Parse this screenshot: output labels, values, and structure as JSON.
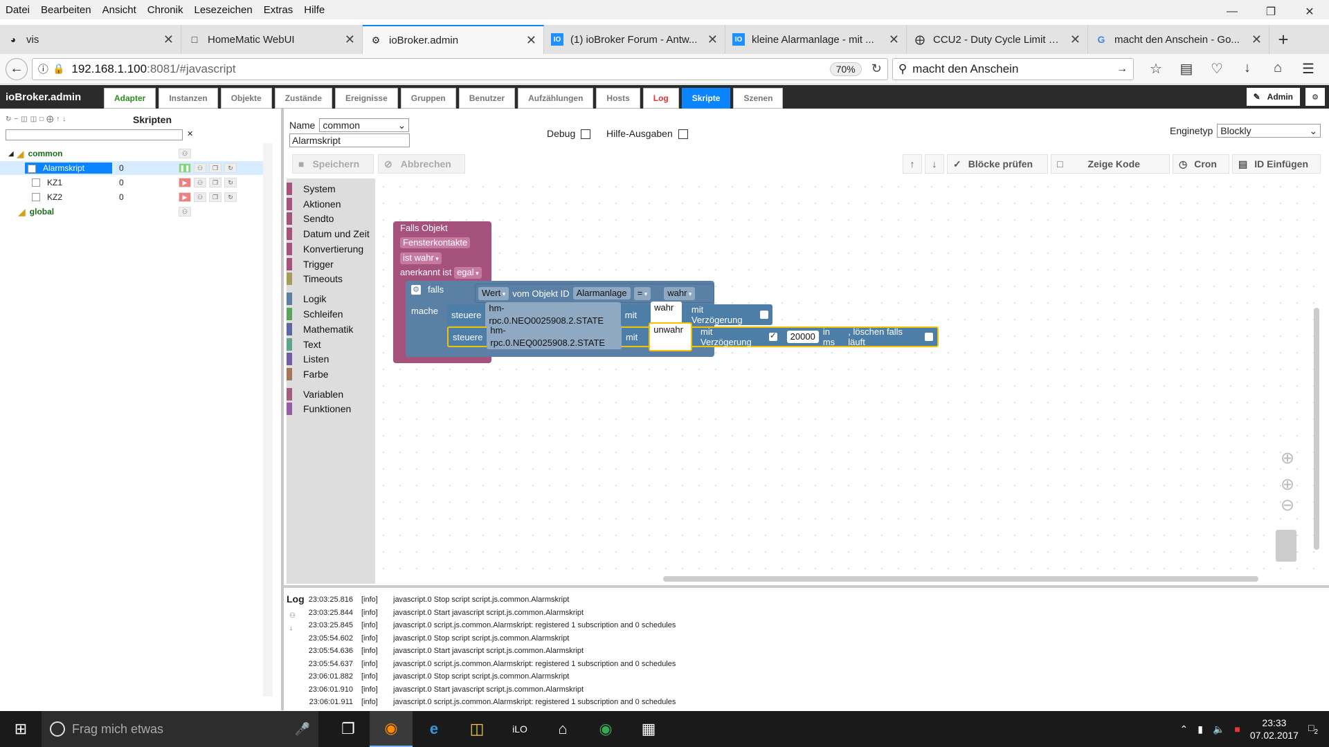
{
  "menu": [
    "Datei",
    "Bearbeiten",
    "Ansicht",
    "Chronik",
    "Lesezeichen",
    "Extras",
    "Hilfe"
  ],
  "tabs": [
    {
      "label": "vis",
      "icon": "vis-icon"
    },
    {
      "label": "HomeMatic WebUI",
      "icon": "page-icon"
    },
    {
      "label": "ioBroker.admin",
      "icon": "gear-icon"
    },
    {
      "label": "(1) ioBroker Forum - Antw...",
      "icon": "iobroker-icon"
    },
    {
      "label": "kleine Alarmanlage - mit ...",
      "icon": "iobroker-icon"
    },
    {
      "label": "CCU2 - Duty Cycle Limit er...",
      "icon": "ccu-icon"
    },
    {
      "label": "macht den Anschein - Go...",
      "icon": "google-icon"
    }
  ],
  "url": {
    "host": "192.168.1.100",
    "path": ":8081/#javascript",
    "zoom": "70%"
  },
  "search": {
    "value": "macht den Anschein"
  },
  "admin": {
    "brand": "ioBroker.admin",
    "tabs": [
      "Adapter",
      "Instanzen",
      "Objekte",
      "Zustände",
      "Ereignisse",
      "Gruppen",
      "Benutzer",
      "Aufzählungen",
      "Hosts",
      "Log",
      "Skripte",
      "Szenen"
    ],
    "user": "Admin"
  },
  "scripts": {
    "title": "Skripten",
    "folders": [
      {
        "name": "common",
        "items": [
          {
            "name": "Alarmskript",
            "value": "0"
          },
          {
            "name": "KZ1",
            "value": "0"
          },
          {
            "name": "KZ2",
            "value": "0"
          }
        ]
      },
      {
        "name": "global",
        "items": []
      }
    ]
  },
  "editor": {
    "name_label": "Name",
    "folder": "common",
    "script_name": "Alarmskript",
    "debug_label": "Debug",
    "hilfe_label": "Hilfe-Ausgaben",
    "engine_label": "Enginetyp",
    "engine": "Blockly",
    "buttons": {
      "save": "Speichern",
      "cancel": "Abbrechen",
      "check": "Blöcke prüfen",
      "code": "Zeige Kode",
      "cron": "Cron",
      "id": "ID Einfügen"
    }
  },
  "toolbox": [
    "System",
    "Aktionen",
    "Sendto",
    "Datum und Zeit",
    "Konvertierung",
    "Trigger",
    "Timeouts",
    "Logik",
    "Schleifen",
    "Mathematik",
    "Text",
    "Listen",
    "Farbe",
    "Variablen",
    "Funktionen"
  ],
  "toolbox_colors": [
    "#a5527c",
    "#a5527c",
    "#a5527c",
    "#a5527c",
    "#a5527c",
    "#a5527c",
    "#a59d5b",
    "#5b80a5",
    "#5ba55b",
    "#5b67a5",
    "#5ba58c",
    "#745ba5",
    "#a5745b",
    "#a55b80",
    "#995ba5"
  ],
  "blocks": {
    "trigger": {
      "title": "Falls Objekt",
      "object": "Fensterkontakte",
      "condition": "ist wahr",
      "ack_label": "anerkannt ist",
      "ack_value": "egal"
    },
    "if": {
      "falls": "falls",
      "mache": "mache",
      "wert": "Wert",
      "vom": "vom Objekt ID",
      "object": "Alarmanlage",
      "op": "=",
      "value": "wahr"
    },
    "control1": {
      "steuere": "steuere",
      "id": "hm-rpc.0.NEQ0025908.2.STATE",
      "mit": "mit",
      "value": "wahr",
      "delay_label": "mit Verzögerung"
    },
    "control2": {
      "steuere": "steuere",
      "id": "hm-rpc.0.NEQ0025908.2.STATE",
      "mit": "mit",
      "value": "unwahr",
      "delay_label": "mit Verzögerung",
      "delay": "20000",
      "unit": "in ms",
      "clear_label": ", löschen falls läuft"
    }
  },
  "log": {
    "label": "Log",
    "rows": [
      {
        "time": "23:03:25.816",
        "sev": "[info]",
        "msg": "javascript.0 Stop script script.js.common.Alarmskript"
      },
      {
        "time": "23:03:25.844",
        "sev": "[info]",
        "msg": "javascript.0 Start javascript script.js.common.Alarmskript"
      },
      {
        "time": "23:03:25.845",
        "sev": "[info]",
        "msg": "javascript.0 script.js.common.Alarmskript: registered 1 subscription and 0 schedules"
      },
      {
        "time": "23:05:54.602",
        "sev": "[info]",
        "msg": "javascript.0 Stop script script.js.common.Alarmskript"
      },
      {
        "time": "23:05:54.636",
        "sev": "[info]",
        "msg": "javascript.0 Start javascript script.js.common.Alarmskript"
      },
      {
        "time": "23:05:54.637",
        "sev": "[info]",
        "msg": "javascript.0 script.js.common.Alarmskript: registered 1 subscription and 0 schedules"
      },
      {
        "time": "23:06:01.882",
        "sev": "[info]",
        "msg": "javascript.0 Stop script script.js.common.Alarmskript"
      },
      {
        "time": "23:06:01.910",
        "sev": "[info]",
        "msg": "javascript.0 Start javascript script.js.common.Alarmskript"
      },
      {
        "time": "23:06:01.911",
        "sev": "[info]",
        "msg": "javascript.0 script.js.common.Alarmskript: registered 1 subscription and 0 schedules"
      }
    ]
  },
  "taskbar": {
    "search_placeholder": "Frag mich etwas",
    "time": "23:33",
    "date": "07.02.2017",
    "notifications": "2"
  }
}
